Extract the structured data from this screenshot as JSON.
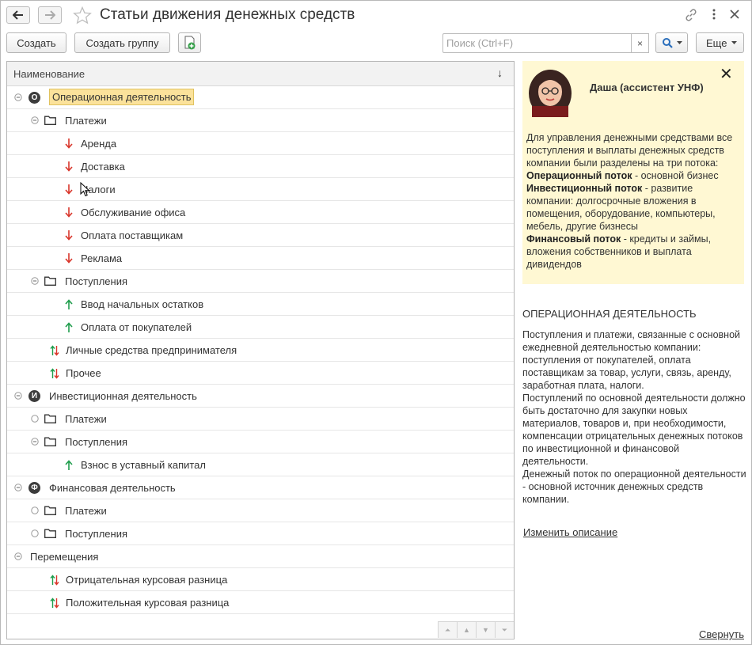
{
  "window": {
    "title": "Статьи движения денежных средств"
  },
  "toolbar": {
    "create_label": "Создать",
    "create_group_label": "Создать группу",
    "search_placeholder": "Поиск (Ctrl+F)",
    "search_clear": "×",
    "more_label": "Еще"
  },
  "tree": {
    "column_header": "Наименование",
    "sort_indicator": "↓",
    "rows": [
      {
        "label": "Операционная деятельность",
        "kind": "root",
        "badge": "О",
        "level": 0,
        "selected": true
      },
      {
        "label": "Платежи",
        "kind": "folder",
        "level": 1,
        "expanded": true
      },
      {
        "label": "Аренда",
        "kind": "outflow",
        "level": 2
      },
      {
        "label": "Доставка",
        "kind": "outflow",
        "level": 2
      },
      {
        "label": "Налоги",
        "kind": "outflow",
        "level": 2
      },
      {
        "label": "Обслуживание офиса",
        "kind": "outflow",
        "level": 2
      },
      {
        "label": "Оплата поставщикам",
        "kind": "outflow",
        "level": 2
      },
      {
        "label": "Реклама",
        "kind": "outflow",
        "level": 2
      },
      {
        "label": "Поступления",
        "kind": "folder",
        "level": 1,
        "expanded": true
      },
      {
        "label": "Ввод начальных остатков",
        "kind": "inflow",
        "level": 2
      },
      {
        "label": "Оплата от покупателей",
        "kind": "inflow",
        "level": 2
      },
      {
        "label": "Личные средства предпринимателя",
        "kind": "both",
        "level": 1
      },
      {
        "label": "Прочее",
        "kind": "both",
        "level": 1
      },
      {
        "label": "Инвестиционная деятельность",
        "kind": "root",
        "badge": "И",
        "level": 0
      },
      {
        "label": "Платежи",
        "kind": "folder",
        "level": 1,
        "expanded": false
      },
      {
        "label": "Поступления",
        "kind": "folder",
        "level": 1,
        "expanded": true
      },
      {
        "label": "Взнос в уставный капитал",
        "kind": "inflow",
        "level": 2
      },
      {
        "label": "Финансовая деятельность",
        "kind": "root",
        "badge": "Ф",
        "level": 0
      },
      {
        "label": "Платежи",
        "kind": "folder",
        "level": 1,
        "expanded": false
      },
      {
        "label": "Поступления",
        "kind": "folder",
        "level": 1,
        "expanded": false
      },
      {
        "label": "Перемещения",
        "kind": "plain-root",
        "level": 0
      },
      {
        "label": "Отрицательная курсовая разница",
        "kind": "both",
        "level": 1
      },
      {
        "label": "Положительная курсовая разница",
        "kind": "both",
        "level": 1
      }
    ]
  },
  "assistant": {
    "name": "Даша (ассистент УНФ)",
    "close": "✕",
    "intro": "Для управления денежными средствами все поступления и выплаты денежных средств компании были разделены на три потока:",
    "flows": [
      {
        "title": "Операционный поток",
        "desc": " - основной бизнес"
      },
      {
        "title": "Инвестиционный поток",
        "desc": " -  развитие компании: долгосрочные вложения в помещения, оборудование, компьютеры, мебель, другие бизнесы"
      },
      {
        "title": "Финансовый поток",
        "desc": " -  кредиты и займы, вложения собственников и выплата дивидендов"
      }
    ]
  },
  "description": {
    "title": "ОПЕРАЦИОННАЯ ДЕЯТЕЛЬНОСТЬ",
    "lines": [
      "Поступления и платежи, связанные с основной ежедневной деятельностью компании:",
      "поступления от покупателей, оплата поставщикам за товар, услуги, связь, аренду, заработная плата, налоги.",
      "Поступлений по основной деятельности должно быть достаточно для закупки новых материалов, товаров и, при необходимости, компенсации отрицательных денежных потоков по инвестиционной и финансовой деятельности.",
      "Денежный поток по операционной деятельности - основной источник денежных средств компании."
    ],
    "edit_link": "Изменить описание",
    "collapse_link": "Свернуть"
  },
  "colors": {
    "outflow_arrow": "#d9362b",
    "inflow_arrow": "#1f9d4c",
    "selection": "#fbe29b",
    "assistant_bg": "#fff8d3"
  }
}
